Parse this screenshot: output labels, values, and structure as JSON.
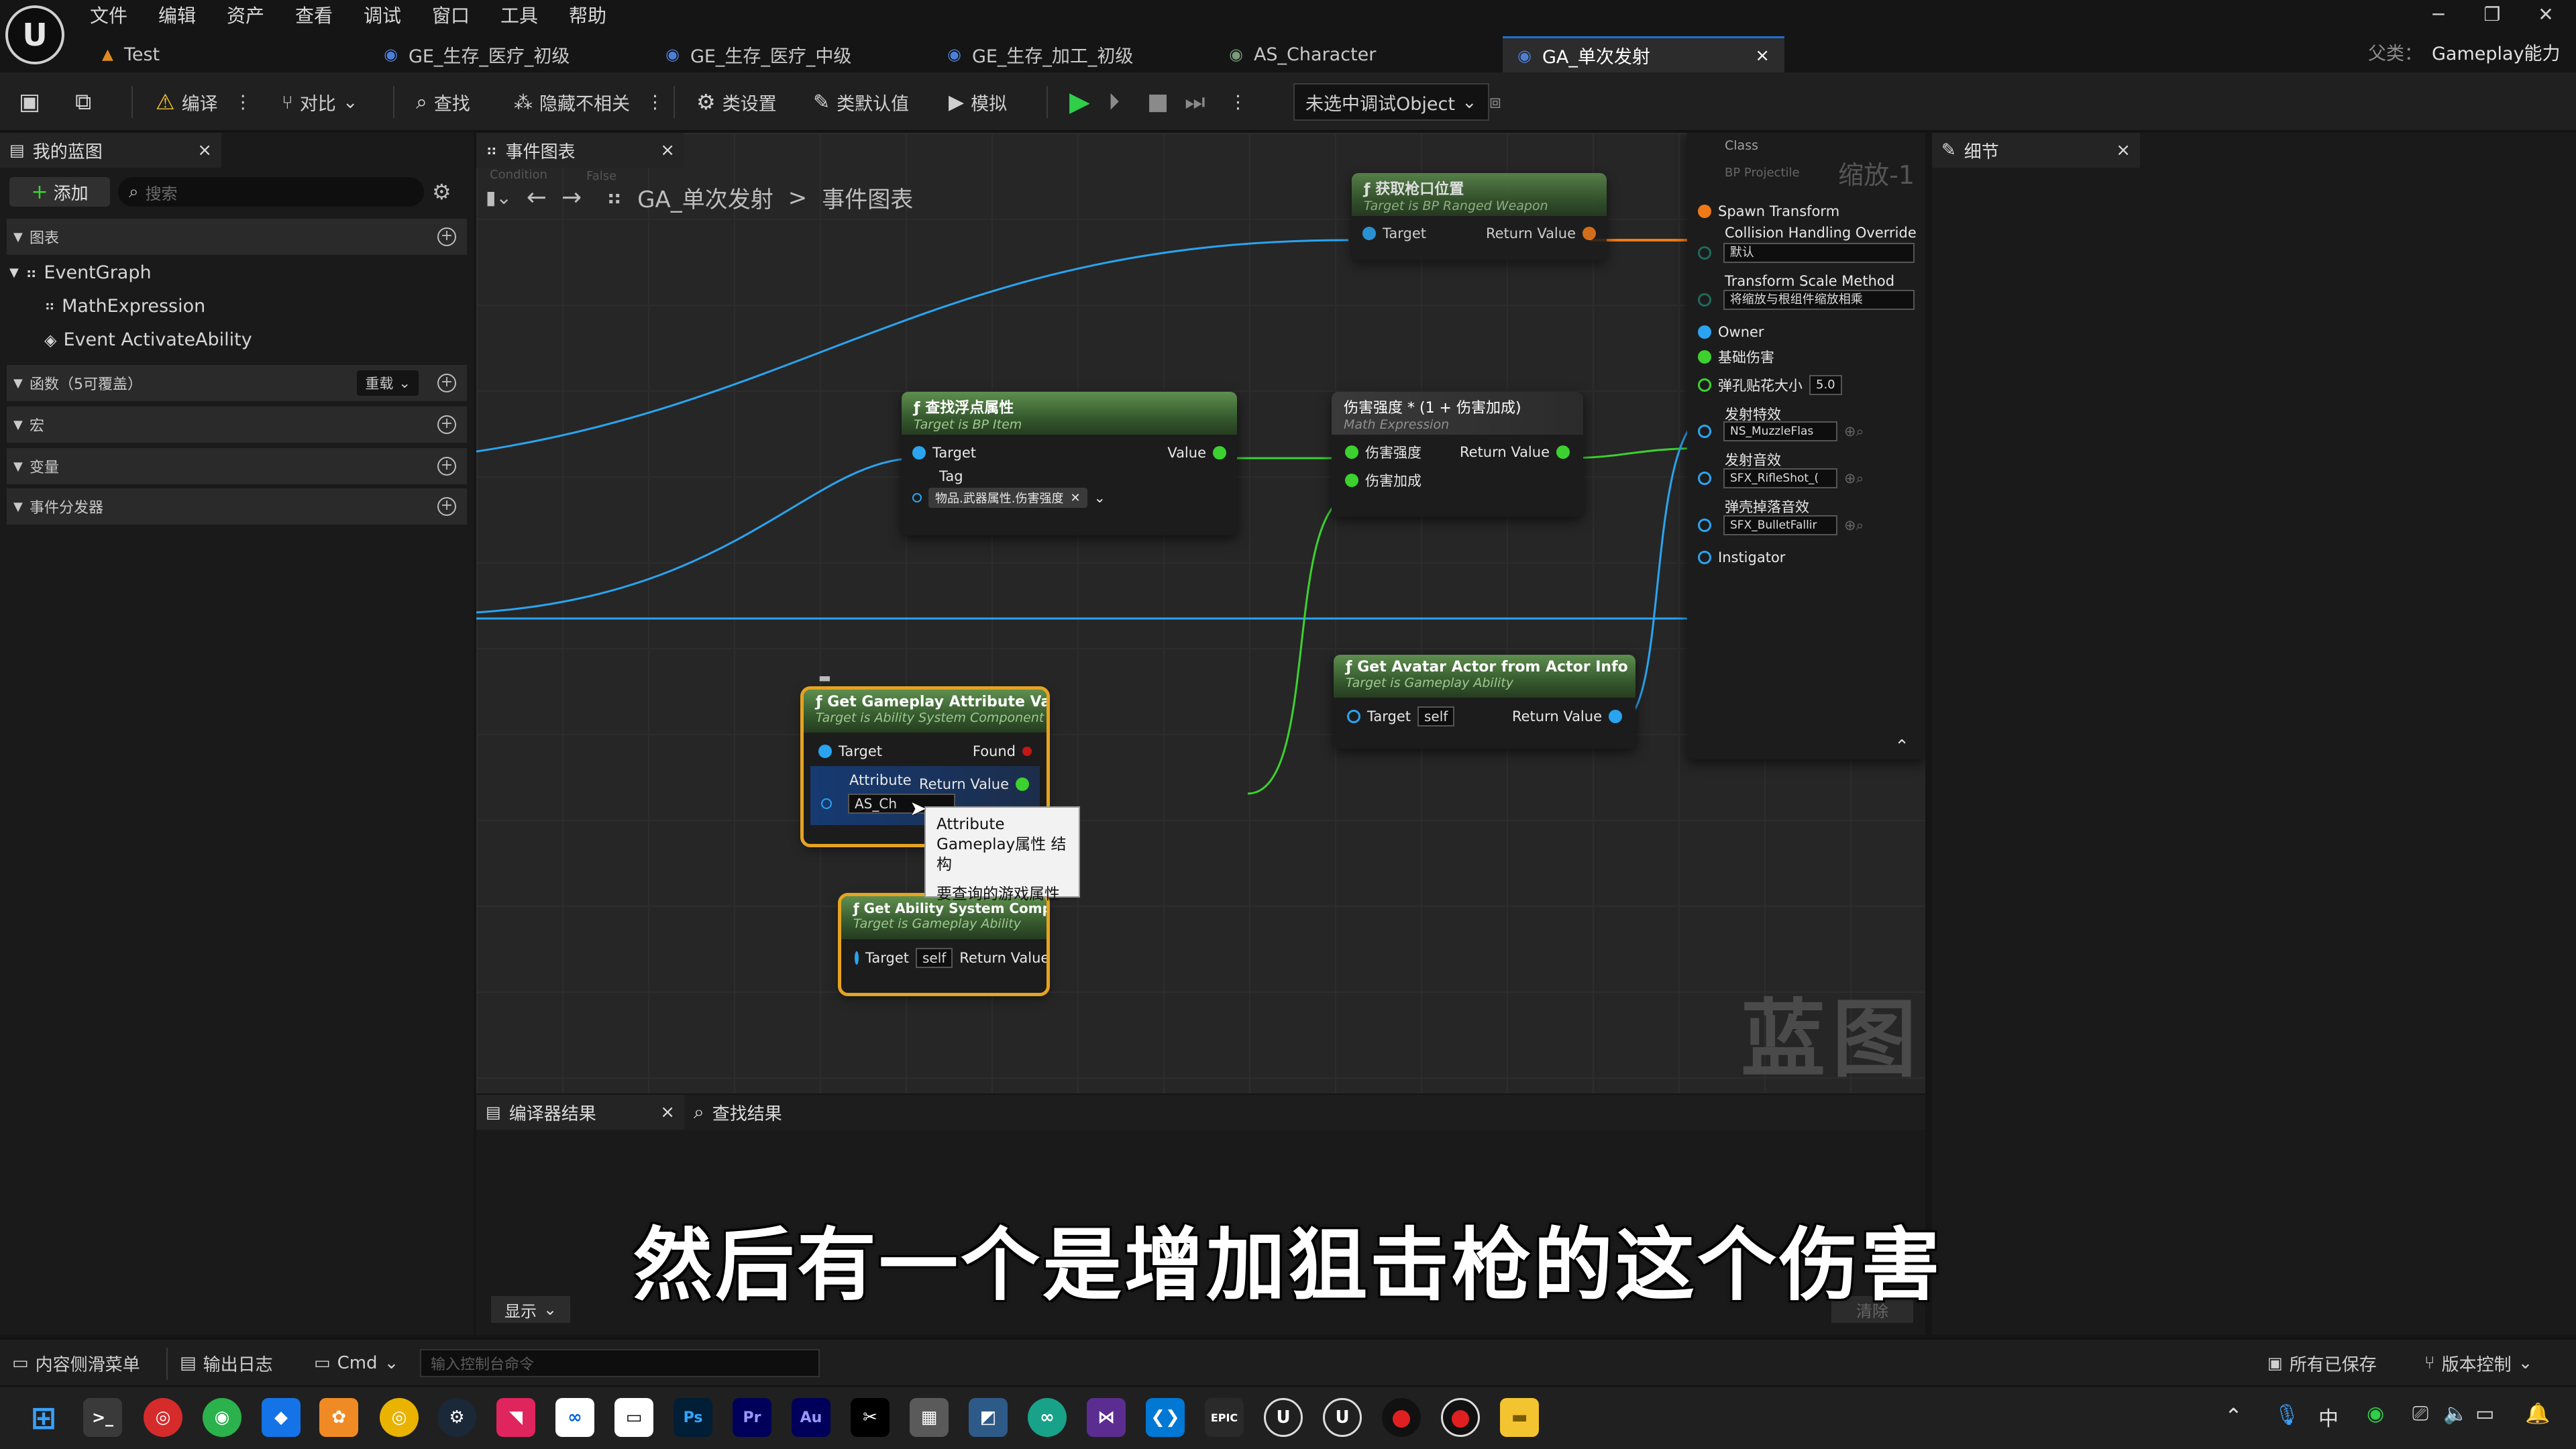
{
  "menu": [
    "文件",
    "编辑",
    "资产",
    "查看",
    "调试",
    "窗口",
    "工具",
    "帮助"
  ],
  "tabs": [
    {
      "label": "Test"
    },
    {
      "label": "GE_生存_医疗_初级"
    },
    {
      "label": "GE_生存_医疗_中级"
    },
    {
      "label": "GE_生存_加工_初级"
    },
    {
      "label": "AS_Character"
    },
    {
      "label": "GA_单次发射",
      "close": "×"
    }
  ],
  "parent": {
    "label": "父类：",
    "value": "Gameplay能力"
  },
  "toolbar": {
    "compile": "编译",
    "diff": "对比",
    "find": "查找",
    "hide_unrelated": "隐藏不相关",
    "class_settings": "类设置",
    "class_defaults": "类默认值",
    "simulate": "模拟",
    "debug_object": "未选中调试Object"
  },
  "left_panel": {
    "tab_title": "我的蓝图",
    "close": "×",
    "add_button": "添加",
    "search_placeholder": "搜索",
    "sections": {
      "graphs": "图表",
      "functions": "函数（5可覆盖）",
      "override": "重载",
      "macros": "宏",
      "variables": "变量",
      "dispatchers": "事件分发器"
    },
    "tree": [
      "EventGraph",
      "MathExpression",
      "Event ActivateAbility"
    ]
  },
  "graph": {
    "tab_title": "事件图表",
    "close": "×",
    "breadcrumb": {
      "blueprint": "GA_单次发射",
      "sep": ">",
      "graph": "事件图表"
    },
    "zoom": "缩放-1",
    "watermark": "蓝图",
    "hidden_labels": {
      "condition": "Condition",
      "false": "False"
    },
    "nodes": {
      "muzzle": {
        "title": "获取枪口位置",
        "subtitle": "Target is BP Ranged Weapon",
        "target": "Target",
        "return": "Return Value"
      },
      "find_attr": {
        "title": "查找浮点属性",
        "subtitle": "Target is BP Item",
        "target": "Target",
        "value": "Value",
        "tag": "Tag",
        "tag_value": "物品.武器属性.伤害强度"
      },
      "math": {
        "title": "伤害强度 * (1 + 伤害加成)",
        "subtitle": "Math Expression",
        "in1": "伤害强度",
        "in2": "伤害加成",
        "return": "Return Value"
      },
      "avatar": {
        "title": "Get Avatar Actor from Actor Info",
        "subtitle": "Target is Gameplay Ability",
        "target": "Target",
        "self": "self",
        "return": "Return Value"
      },
      "get_attr": {
        "title": "Get Gameplay Attribute Value",
        "subtitle": "Target is Ability System Component",
        "target": "Target",
        "found": "Found",
        "attribute": "Attribute",
        "attribute_value": "AS_Ch",
        "return": "Return Value"
      },
      "asc": {
        "title": "Get Ability System Component from Actor Info",
        "subtitle": "Target is Gameplay Ability",
        "target": "Target",
        "self": "self",
        "return": "Return Value"
      },
      "spawn": {
        "class": "Class",
        "class_value": "BP Projectile",
        "spawn_transform": "Spawn Transform",
        "collision": "Collision Handling Override",
        "collision_value": "默认",
        "scale": "Transform Scale Method",
        "scale_value": "将缩放与根组件缩放相乘",
        "owner": "Owner",
        "base_damage": "基础伤害",
        "decal": "弹孔贴花大小",
        "decal_value": "5.0",
        "fire_fx": "发射特效",
        "fire_fx_value": "NS_MuzzleFlas",
        "fire_sfx": "发射音效",
        "fire_sfx_value": "SFX_RifleShot_(",
        "shell_sfx": "弹壳掉落音效",
        "shell_sfx_value": "SFX_BulletFallir",
        "instigator": "Instigator"
      }
    },
    "tooltip": {
      "line1": "Attribute",
      "line2": "Gameplay属性 结构",
      "line3": "要查询的游戏属性"
    }
  },
  "bottom_panel": {
    "compiler_tab": "编译器结果",
    "close": "×",
    "find_tab": "查找结果",
    "show_button": "显示",
    "clear_button": "清除"
  },
  "details_panel": {
    "title": "细节",
    "close": "×"
  },
  "status_bar": {
    "content_drawer": "内容侧滑菜单",
    "output_log": "输出日志",
    "cmd": "Cmd",
    "console_placeholder": "输入控制台命令",
    "all_saved": "所有已保存",
    "version_control": "版本控制"
  },
  "subtitle": "然后有一个是增加狙击枪的这个伤害",
  "taskbar": {
    "ime": "中"
  },
  "colors": {
    "accent": "#1d6fd4",
    "exec_blue": "#2aa4f0",
    "float_green": "#3cd12f",
    "select_orange": "#e6a321",
    "play_green": "#2fcf4a"
  }
}
